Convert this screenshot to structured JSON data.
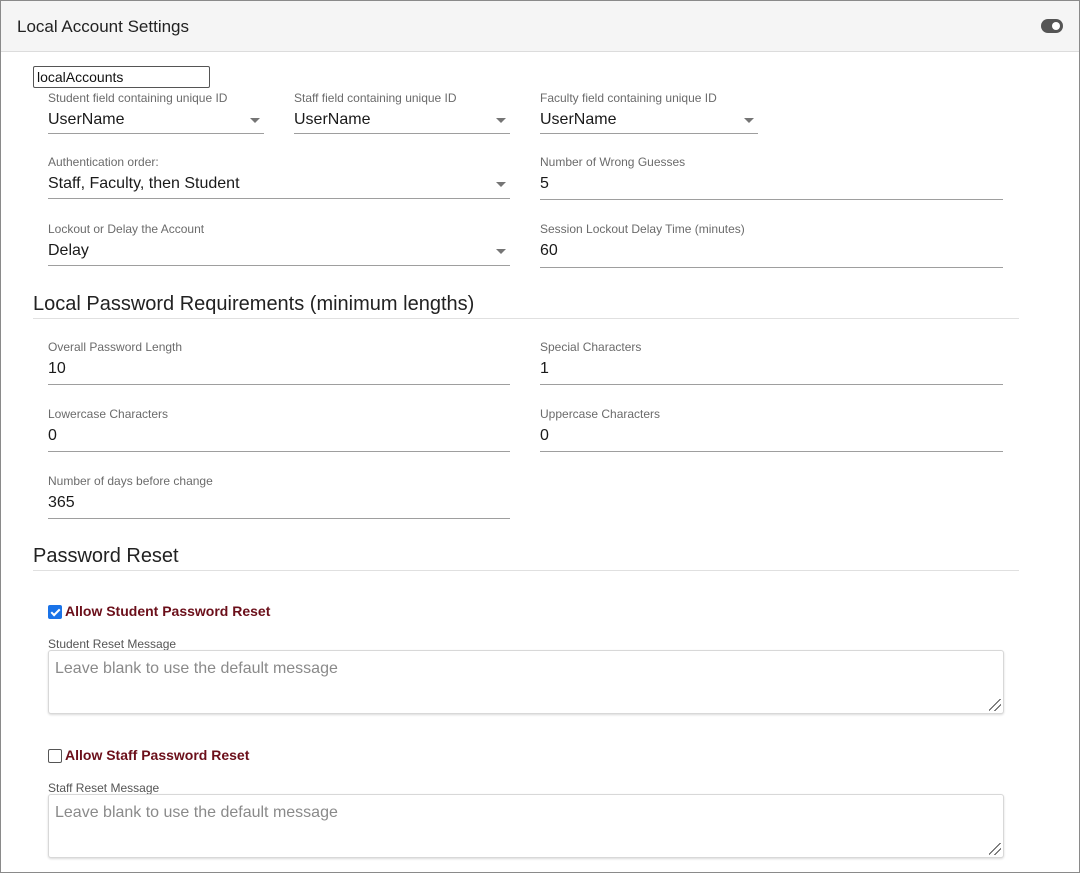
{
  "header": {
    "title": "Local Account Settings"
  },
  "identifier_input": {
    "value": "localAccounts"
  },
  "fields": {
    "student_unique_id": {
      "label": "Student field containing unique ID",
      "value": "UserName"
    },
    "staff_unique_id": {
      "label": "Staff field containing unique ID",
      "value": "UserName"
    },
    "faculty_unique_id": {
      "label": "Faculty field containing unique ID",
      "value": "UserName"
    },
    "auth_order": {
      "label": "Authentication order:",
      "value": "Staff, Faculty, then Student"
    },
    "wrong_guesses": {
      "label": "Number of Wrong Guesses",
      "value": "5"
    },
    "lockout_or_delay": {
      "label": "Lockout or Delay the Account",
      "value": "Delay"
    },
    "lockout_delay_time": {
      "label": "Session Lockout Delay Time (minutes)",
      "value": "60"
    }
  },
  "password_requirements": {
    "heading": "Local Password Requirements (minimum lengths)",
    "overall_length": {
      "label": "Overall Password Length",
      "value": "10"
    },
    "special_chars": {
      "label": "Special Characters",
      "value": "1"
    },
    "lowercase_chars": {
      "label": "Lowercase Characters",
      "value": "0"
    },
    "uppercase_chars": {
      "label": "Uppercase Characters",
      "value": "0"
    },
    "days_before_change": {
      "label": "Number of days before change",
      "value": "365"
    }
  },
  "password_reset": {
    "heading": "Password Reset",
    "student": {
      "checkbox_label": "Allow Student Password Reset",
      "checked": true,
      "message_label": "Student Reset Message",
      "placeholder": "Leave blank to use the default message"
    },
    "staff": {
      "checkbox_label": "Allow Staff Password Reset",
      "checked": false,
      "message_label": "Staff Reset Message",
      "placeholder": "Leave blank to use the default message"
    }
  },
  "colors": {
    "accent": "#1a73e8",
    "checkbox_label": "#6b0f1a"
  }
}
